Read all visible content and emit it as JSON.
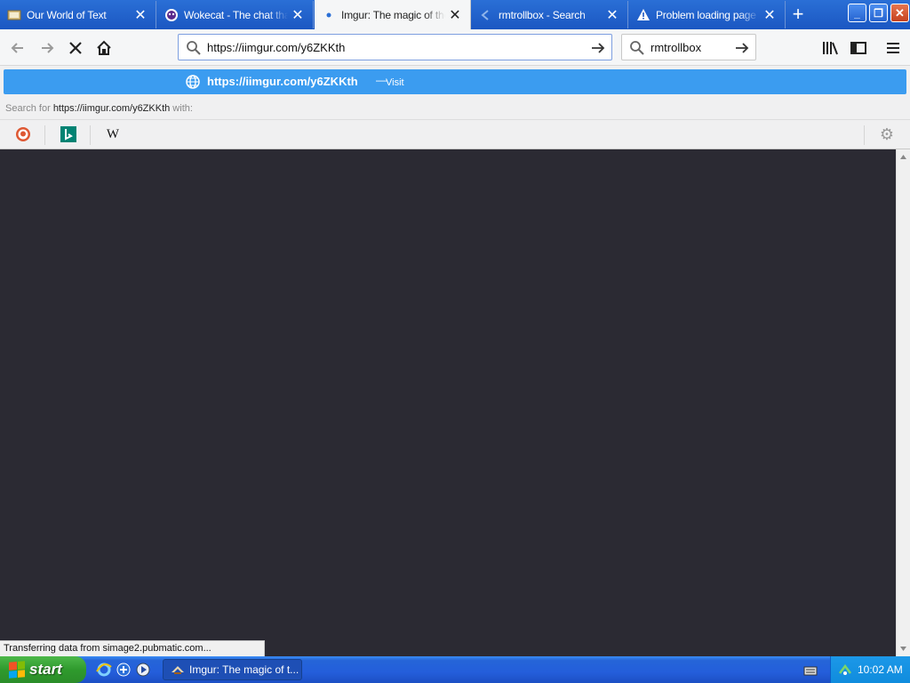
{
  "tabs": [
    {
      "title": "Our World of Text",
      "favicon": "owot-icon"
    },
    {
      "title": "Wokecat - The chat that",
      "favicon": "wokecat-icon"
    },
    {
      "title": "Imgur: The magic of the",
      "favicon": "loading-dot-icon",
      "active": true
    },
    {
      "title": "rmtrollbox - Search",
      "favicon": "search-icon"
    },
    {
      "title": "Problem loading page",
      "favicon": "warning-icon"
    }
  ],
  "navbar": {
    "url_value": "https://iimgur.com/y6ZKKth",
    "search_value": "rmtrollbox"
  },
  "dropdown": {
    "suggestion_url": "https://iimgur.com/y6ZKKth",
    "suggestion_sep": "—",
    "suggestion_action": "Visit",
    "search_for_prefix": "Search for ",
    "search_for_query": "https://iimgur.com/y6ZKKth",
    "search_for_suffix": " with:",
    "engines": [
      "duckduckgo-icon",
      "bing-icon",
      "wikipedia-icon"
    ]
  },
  "status": "Transferring data from simage2.pubmatic.com...",
  "taskbar": {
    "start_label": "start",
    "task_label": "Imgur: The magic of t...",
    "clock": "10:02 AM"
  },
  "colors": {
    "suggestion_bg": "#3b9cf0",
    "content_bg": "#2b2a33",
    "xp_blue": "#245edb",
    "start_green": "#2f9a2d"
  }
}
